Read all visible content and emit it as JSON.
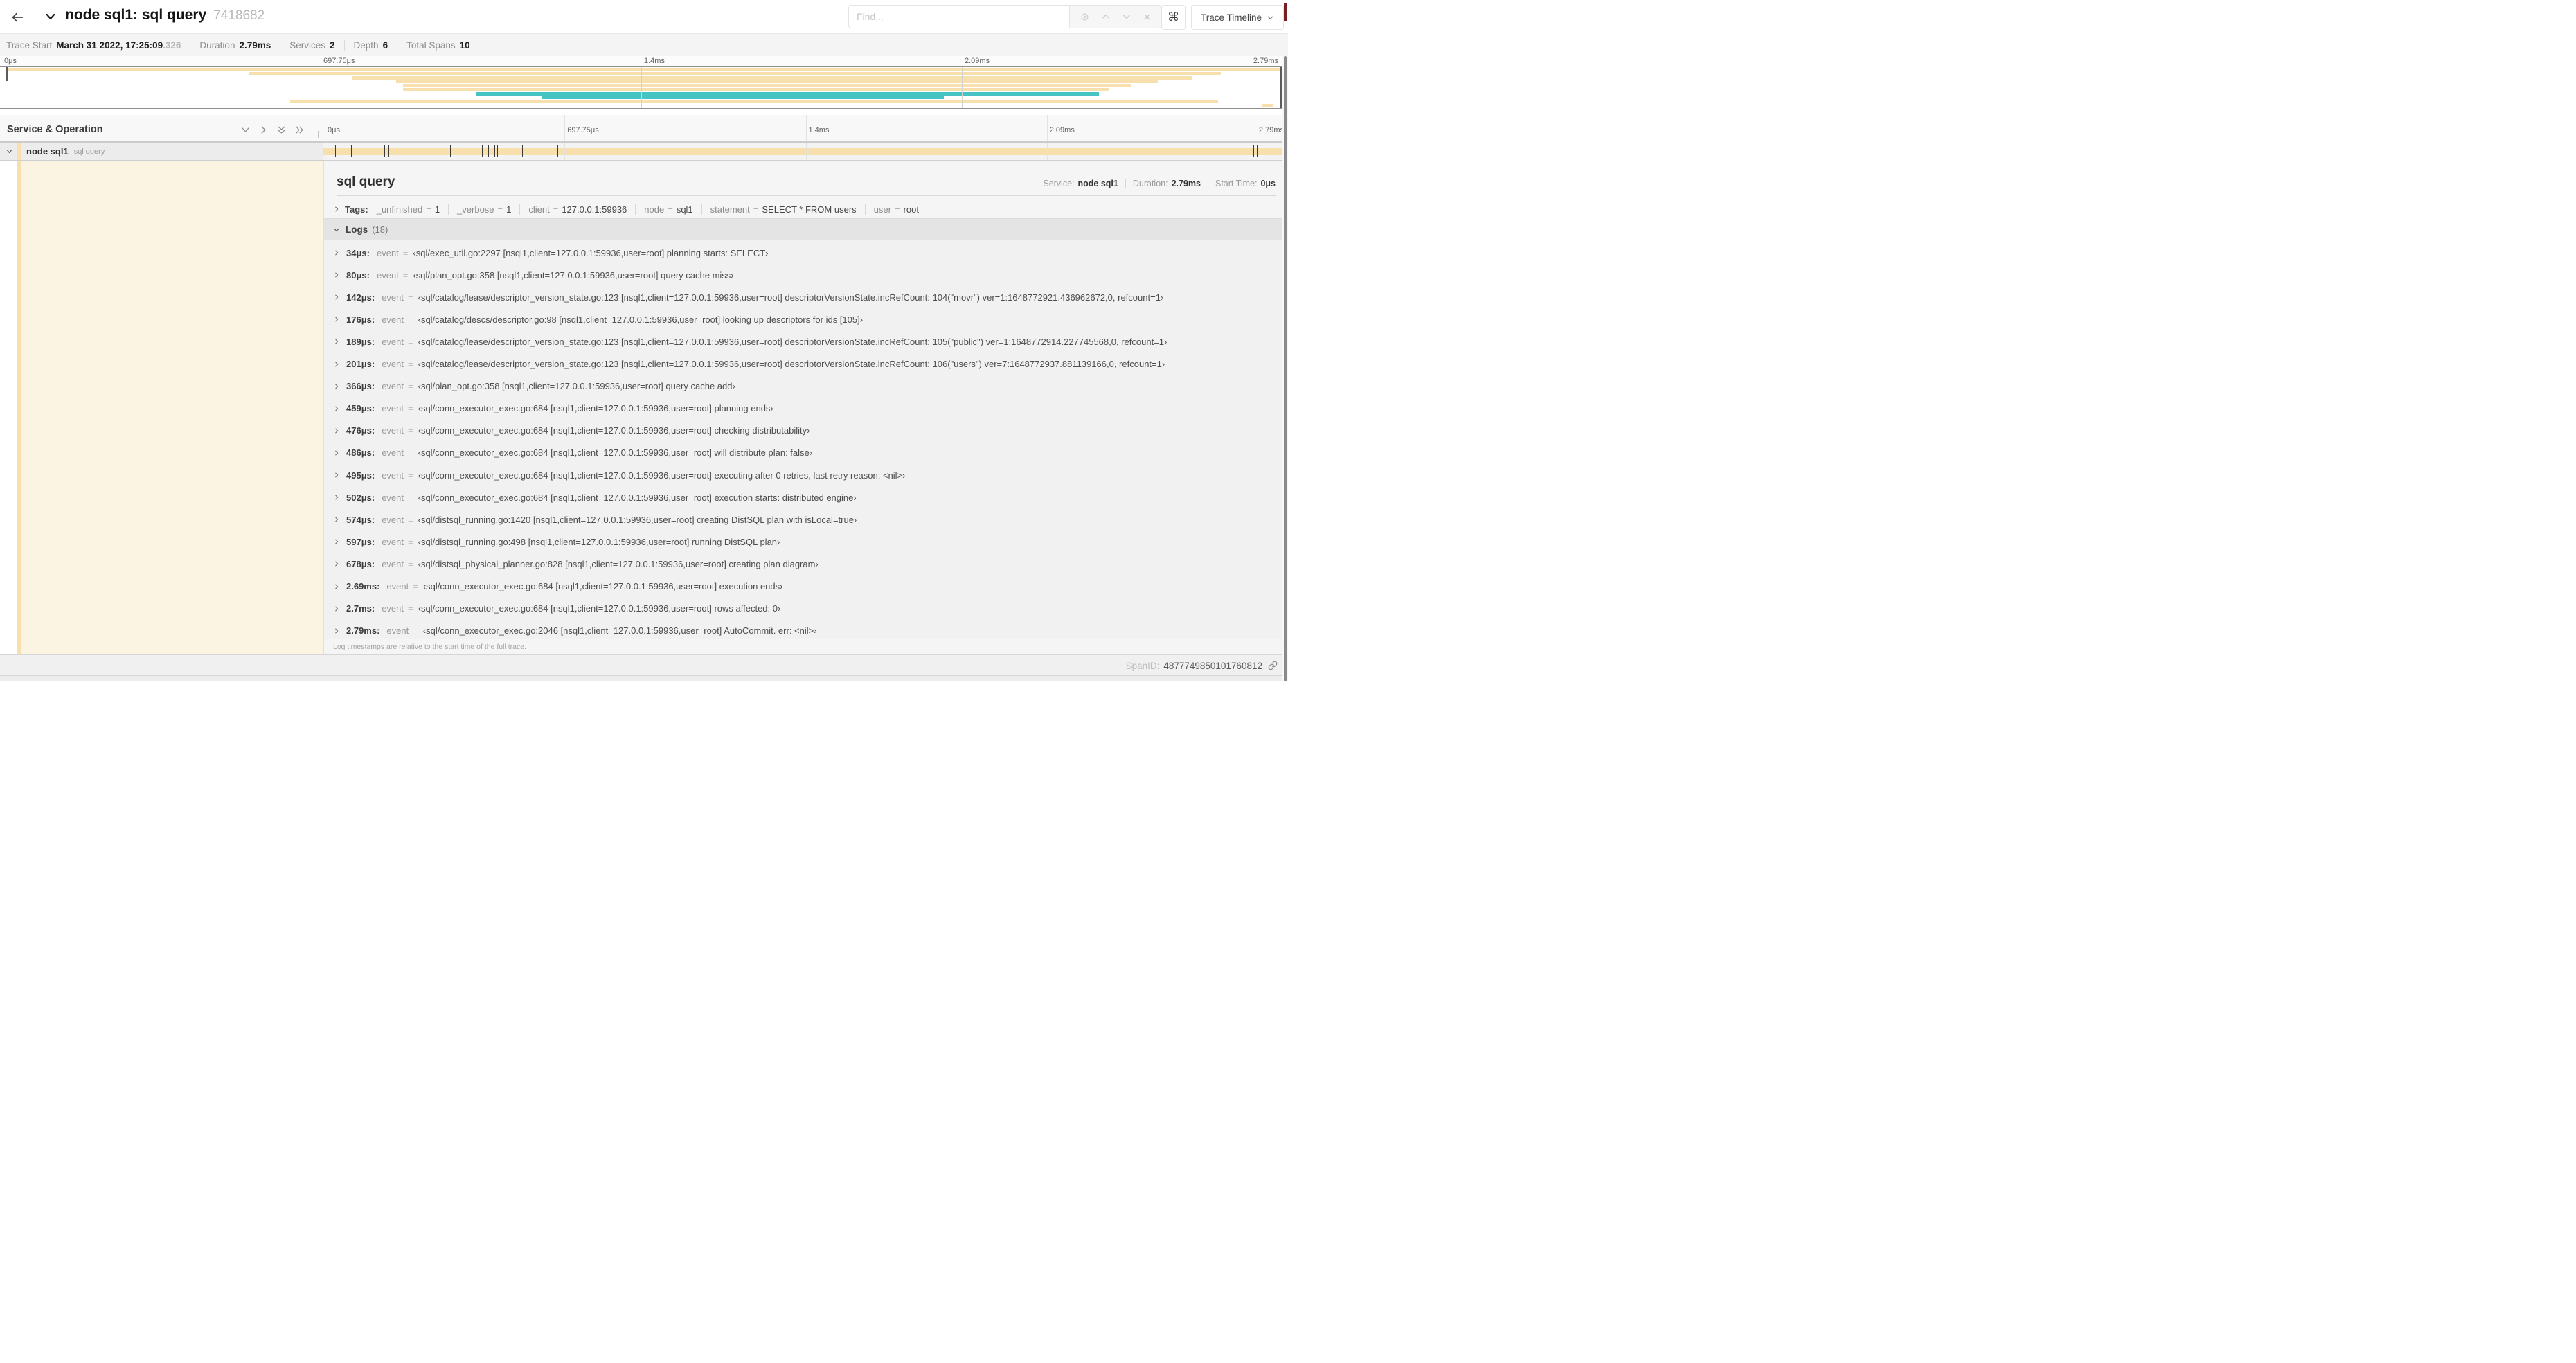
{
  "header": {
    "title": "node sql1: sql query",
    "trace_id": "7418682",
    "find_placeholder": "Find...",
    "shortcut_icon": "⌘",
    "view_button": "Trace Timeline"
  },
  "trace_bar": {
    "items": [
      {
        "label": "Trace Start",
        "value": "March 31 2022, 17:25:09",
        "suffix": ".326"
      },
      {
        "label": "Duration",
        "value": "2.79ms"
      },
      {
        "label": "Services",
        "value": "2"
      },
      {
        "label": "Depth",
        "value": "6"
      },
      {
        "label": "Total Spans",
        "value": "10"
      }
    ]
  },
  "colors": {
    "span_tan": "#f7e0ae",
    "span_teal": "#46c3c3"
  },
  "minimap": {
    "ticks": [
      {
        "label": "0μs",
        "pct": 0
      },
      {
        "label": "697.75μs",
        "pct": 25
      },
      {
        "label": "1.4ms",
        "pct": 50
      },
      {
        "label": "2.09ms",
        "pct": 75
      },
      {
        "label": "2.79ms",
        "pct": 100
      }
    ],
    "spans": [
      {
        "start": 0.5,
        "end": 99.8,
        "color": "#f7e0ae"
      },
      {
        "start": 19.4,
        "end": 95.2,
        "color": "#f7e0ae"
      },
      {
        "start": 27.5,
        "end": 92.9,
        "color": "#f7e0ae"
      },
      {
        "start": 30.9,
        "end": 90.3,
        "color": "#f7e0ae"
      },
      {
        "start": 31.4,
        "end": 88.2,
        "color": "#f7e0ae"
      },
      {
        "start": 31.4,
        "end": 86.5,
        "color": "#f7e0ae"
      },
      {
        "start": 37.1,
        "end": 85.7,
        "color": "#46c3c3"
      },
      {
        "start": 42.2,
        "end": 73.6,
        "color": "#46c3c3"
      },
      {
        "start": 22.6,
        "end": 95.0,
        "color": "#f7e0ae"
      },
      {
        "start": 98.4,
        "end": 99.3,
        "color": "#f7e0ae"
      }
    ]
  },
  "timeline": {
    "left_header": "Service & Operation",
    "ticks": [
      {
        "label": "0μs",
        "pct": 0
      },
      {
        "label": "697.75μs",
        "pct": 25
      },
      {
        "label": "1.4ms",
        "pct": 50
      },
      {
        "label": "2.09ms",
        "pct": 75
      },
      {
        "label": "2.79ms",
        "pct": 100
      }
    ]
  },
  "row": {
    "service": "node sql1",
    "operation": "sql query",
    "bar_start_pct": 0,
    "bar_end_pct": 100,
    "bar_color": "#f7e0ae",
    "log_marker_pcts": [
      1.22,
      2.87,
      5.09,
      6.31,
      6.77,
      7.2,
      13.12,
      16.45,
      17.06,
      17.42,
      17.74,
      17.99,
      20.57,
      21.4,
      24.3,
      96.42,
      96.77,
      100
    ]
  },
  "detail": {
    "operation": "sql query",
    "meta": [
      {
        "label": "Service:",
        "value": "node sql1"
      },
      {
        "label": "Duration:",
        "value": "2.79ms"
      },
      {
        "label": "Start Time:",
        "value": "0μs"
      }
    ],
    "tags_label": "Tags:",
    "tags": [
      {
        "key": "_unfinished",
        "value": "1"
      },
      {
        "key": "_verbose",
        "value": "1"
      },
      {
        "key": "client",
        "value": "127.0.0.1:59936"
      },
      {
        "key": "node",
        "value": "sql1"
      },
      {
        "key": "statement",
        "value": "SELECT * FROM users"
      },
      {
        "key": "user",
        "value": "root"
      }
    ],
    "logs_label": "Logs",
    "logs_count": "(18)",
    "log_field_label": "event",
    "logs": [
      {
        "time": "34μs:",
        "value": "‹sql/exec_util.go:2297 [nsql1,client=127.0.0.1:59936,user=root] planning starts: SELECT›"
      },
      {
        "time": "80μs:",
        "value": "‹sql/plan_opt.go:358 [nsql1,client=127.0.0.1:59936,user=root] query cache miss›"
      },
      {
        "time": "142μs:",
        "value": "‹sql/catalog/lease/descriptor_version_state.go:123 [nsql1,client=127.0.0.1:59936,user=root] descriptorVersionState.incRefCount: 104(\"movr\") ver=1:1648772921.436962672,0, refcount=1›"
      },
      {
        "time": "176μs:",
        "value": "‹sql/catalog/descs/descriptor.go:98 [nsql1,client=127.0.0.1:59936,user=root] looking up descriptors for ids [105]›"
      },
      {
        "time": "189μs:",
        "value": "‹sql/catalog/lease/descriptor_version_state.go:123 [nsql1,client=127.0.0.1:59936,user=root] descriptorVersionState.incRefCount: 105(\"public\") ver=1:1648772914.227745568,0, refcount=1›"
      },
      {
        "time": "201μs:",
        "value": "‹sql/catalog/lease/descriptor_version_state.go:123 [nsql1,client=127.0.0.1:59936,user=root] descriptorVersionState.incRefCount: 106(\"users\") ver=7:1648772937.881139166,0, refcount=1›"
      },
      {
        "time": "366μs:",
        "value": "‹sql/plan_opt.go:358 [nsql1,client=127.0.0.1:59936,user=root] query cache add›"
      },
      {
        "time": "459μs:",
        "value": "‹sql/conn_executor_exec.go:684 [nsql1,client=127.0.0.1:59936,user=root] planning ends›"
      },
      {
        "time": "476μs:",
        "value": "‹sql/conn_executor_exec.go:684 [nsql1,client=127.0.0.1:59936,user=root] checking distributability›"
      },
      {
        "time": "486μs:",
        "value": "‹sql/conn_executor_exec.go:684 [nsql1,client=127.0.0.1:59936,user=root] will distribute plan: false›"
      },
      {
        "time": "495μs:",
        "value": "‹sql/conn_executor_exec.go:684 [nsql1,client=127.0.0.1:59936,user=root] executing after 0 retries, last retry reason: <nil>›"
      },
      {
        "time": "502μs:",
        "value": "‹sql/conn_executor_exec.go:684 [nsql1,client=127.0.0.1:59936,user=root] execution starts: distributed engine›"
      },
      {
        "time": "574μs:",
        "value": "‹sql/distsql_running.go:1420 [nsql1,client=127.0.0.1:59936,user=root] creating DistSQL plan with isLocal=true›"
      },
      {
        "time": "597μs:",
        "value": "‹sql/distsql_running.go:498 [nsql1,client=127.0.0.1:59936,user=root] running DistSQL plan›"
      },
      {
        "time": "678μs:",
        "value": "‹sql/distsql_physical_planner.go:828 [nsql1,client=127.0.0.1:59936,user=root] creating plan diagram›"
      },
      {
        "time": "2.69ms:",
        "value": "‹sql/conn_executor_exec.go:684 [nsql1,client=127.0.0.1:59936,user=root] execution ends›"
      },
      {
        "time": "2.7ms:",
        "value": "‹sql/conn_executor_exec.go:684 [nsql1,client=127.0.0.1:59936,user=root] rows affected: 0›"
      },
      {
        "time": "2.79ms:",
        "value": "‹sql/conn_executor_exec.go:2046 [nsql1,client=127.0.0.1:59936,user=root] AutoCommit. err: <nil>›"
      }
    ],
    "footer_note": "Log timestamps are relative to the start time of the full trace.",
    "span_id_label": "SpanID:",
    "span_id": "4877749850101760812"
  }
}
